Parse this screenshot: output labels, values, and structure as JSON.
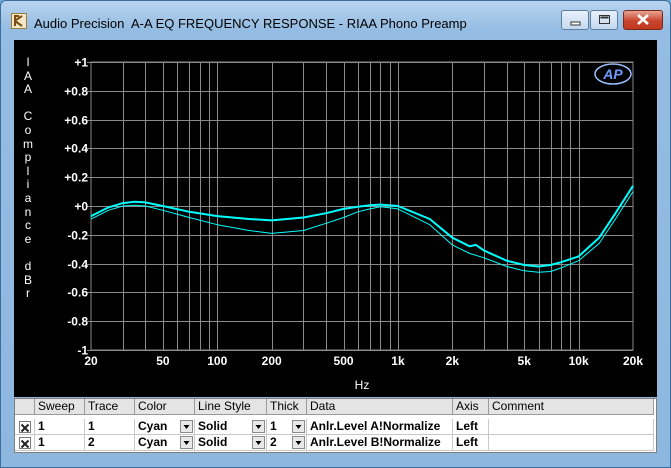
{
  "window": {
    "app_name": "Audio Precision",
    "document_title": "A-A EQ FREQUENCY RESPONSE - RIAA Phono Preamp"
  },
  "graph": {
    "logo_text": "AP",
    "y_label": "IAA Compliance dBr",
    "x_label": "Hz",
    "y_ticks": [
      "+1",
      "+0.8",
      "+0.6",
      "+0.4",
      "+0.2",
      "+0",
      "-0.2",
      "-0.4",
      "-0.6",
      "-0.8",
      "-1"
    ],
    "x_ticks": [
      "20",
      "50",
      "100",
      "200",
      "500",
      "1k",
      "2k",
      "5k",
      "10k",
      "20k"
    ],
    "colors": {
      "background": "#000000",
      "grid": "#8a8a8a",
      "trace": "#00ffff",
      "text": "#ffffff"
    }
  },
  "chart_data": {
    "type": "line",
    "title": "A-A EQ FREQUENCY RESPONSE - RIAA Phono Preamp",
    "xlabel": "Hz",
    "ylabel": "IAA Compliance dBr",
    "xscale": "log",
    "xlim": [
      20,
      20000
    ],
    "ylim": [
      -1,
      1
    ],
    "grid": true,
    "series": [
      {
        "name": "Anlr.Level A!Normalize",
        "color": "#00ffff",
        "thickness": 1,
        "x": [
          18,
          20,
          25,
          30,
          35,
          40,
          50,
          70,
          100,
          150,
          200,
          300,
          400,
          500,
          600,
          700,
          800,
          1000,
          1500,
          2000,
          2500,
          3000,
          4000,
          5000,
          6000,
          7000,
          8000,
          10000,
          13000,
          16000,
          20000
        ],
        "y": [
          -0.15,
          -0.09,
          -0.03,
          0.0,
          0.005,
          0.0,
          -0.03,
          -0.08,
          -0.13,
          -0.17,
          -0.19,
          -0.17,
          -0.12,
          -0.08,
          -0.04,
          -0.02,
          -0.005,
          -0.02,
          -0.13,
          -0.27,
          -0.33,
          -0.36,
          -0.42,
          -0.45,
          -0.46,
          -0.455,
          -0.43,
          -0.38,
          -0.26,
          -0.09,
          0.1
        ]
      },
      {
        "name": "Anlr.Level B!Normalize",
        "color": "#00ffff",
        "thickness": 2,
        "x": [
          18,
          20,
          25,
          30,
          35,
          40,
          50,
          70,
          100,
          150,
          200,
          300,
          400,
          500,
          600,
          700,
          800,
          1000,
          1500,
          2000,
          2500,
          2700,
          3000,
          4000,
          5000,
          6000,
          7000,
          8000,
          10000,
          13000,
          16000,
          20000
        ],
        "y": [
          -0.13,
          -0.07,
          -0.01,
          0.02,
          0.03,
          0.025,
          0.0,
          -0.04,
          -0.07,
          -0.09,
          -0.1,
          -0.08,
          -0.05,
          -0.02,
          -0.005,
          0.005,
          0.01,
          0.0,
          -0.09,
          -0.22,
          -0.28,
          -0.27,
          -0.31,
          -0.38,
          -0.41,
          -0.42,
          -0.41,
          -0.39,
          -0.35,
          -0.22,
          -0.05,
          0.14
        ]
      }
    ]
  },
  "table": {
    "headers": [
      "Sweep",
      "Trace",
      "Color",
      "Line Style",
      "Thick",
      "Data",
      "Axis",
      "Comment"
    ],
    "rows": [
      {
        "checked": true,
        "sweep": "1",
        "trace": "1",
        "color": "Cyan",
        "line_style": "Solid",
        "thick": "1",
        "data": "Anlr.Level A!Normalize",
        "axis": "Left",
        "comment": ""
      },
      {
        "checked": true,
        "sweep": "1",
        "trace": "2",
        "color": "Cyan",
        "line_style": "Solid",
        "thick": "2",
        "data": "Anlr.Level B!Normalize",
        "axis": "Left",
        "comment": ""
      }
    ]
  }
}
